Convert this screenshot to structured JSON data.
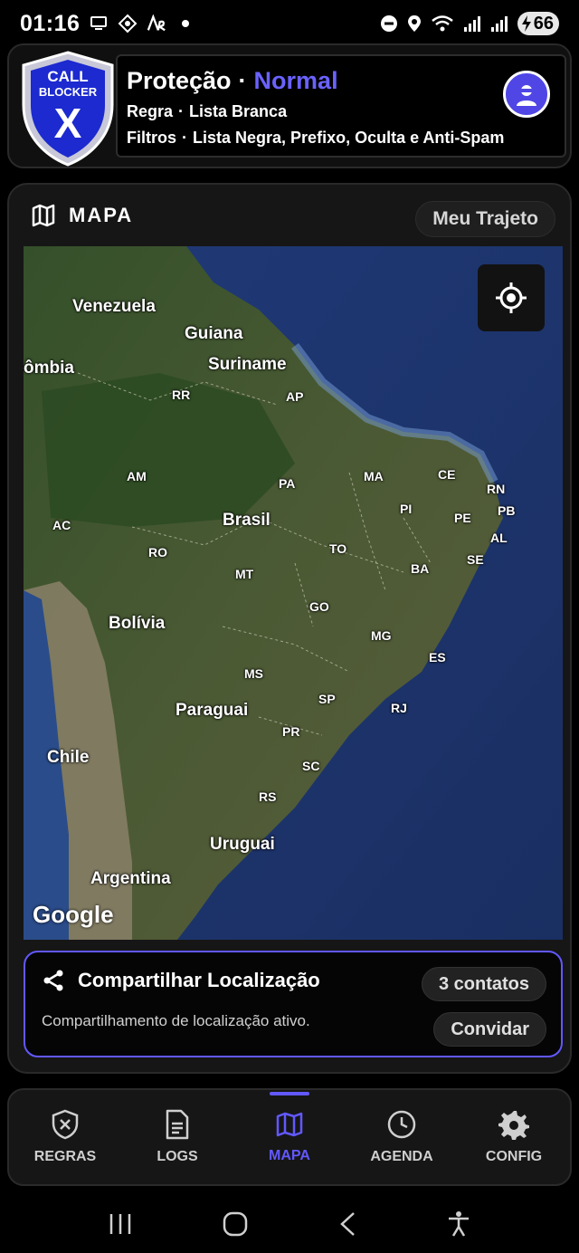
{
  "status_bar": {
    "time": "01:16",
    "battery": "66"
  },
  "header": {
    "logo_text_line1": "CALL",
    "logo_text_line2": "BLOCKER",
    "logo_text_line3": "X",
    "title": "Proteção",
    "title_separator": "·",
    "status": "Normal",
    "rule_label": "Regra",
    "rule_separator": "·",
    "rule_value": "Lista Branca",
    "filters_label": "Filtros",
    "filters_separator": "·",
    "filters_value": "Lista Negra, Prefixo, Oculta e Anti-Spam"
  },
  "map_section": {
    "title": "MAPA",
    "route_button": "Meu Trajeto",
    "attribution": "Google",
    "countries": [
      "Venezuela",
      "Guiana",
      "Suriname",
      "ômbia",
      "Brasil",
      "Bolívia",
      "Paraguai",
      "Chile",
      "Uruguai",
      "Argentina"
    ],
    "states": [
      "RR",
      "AP",
      "AM",
      "PA",
      "MA",
      "CE",
      "RN",
      "PI",
      "PB",
      "PE",
      "AL",
      "AC",
      "RO",
      "TO",
      "MT",
      "BA",
      "SE",
      "GO",
      "MG",
      "ES",
      "MS",
      "SP",
      "RJ",
      "PR",
      "SC",
      "RS"
    ]
  },
  "share": {
    "title": "Compartilhar Localização",
    "subtitle": "Compartilhamento de localização ativo.",
    "contacts": "3 contatos",
    "invite": "Convidar"
  },
  "nav": {
    "items": [
      {
        "label": "REGRAS",
        "icon": "shield-x-icon"
      },
      {
        "label": "LOGS",
        "icon": "document-icon"
      },
      {
        "label": "MAPA",
        "icon": "map-icon"
      },
      {
        "label": "AGENDA",
        "icon": "clock-icon"
      },
      {
        "label": "CONFIG",
        "icon": "gear-icon"
      }
    ],
    "active": "MAPA"
  },
  "colors": {
    "accent": "#6258ff",
    "background": "#000000",
    "card": "#161616"
  }
}
